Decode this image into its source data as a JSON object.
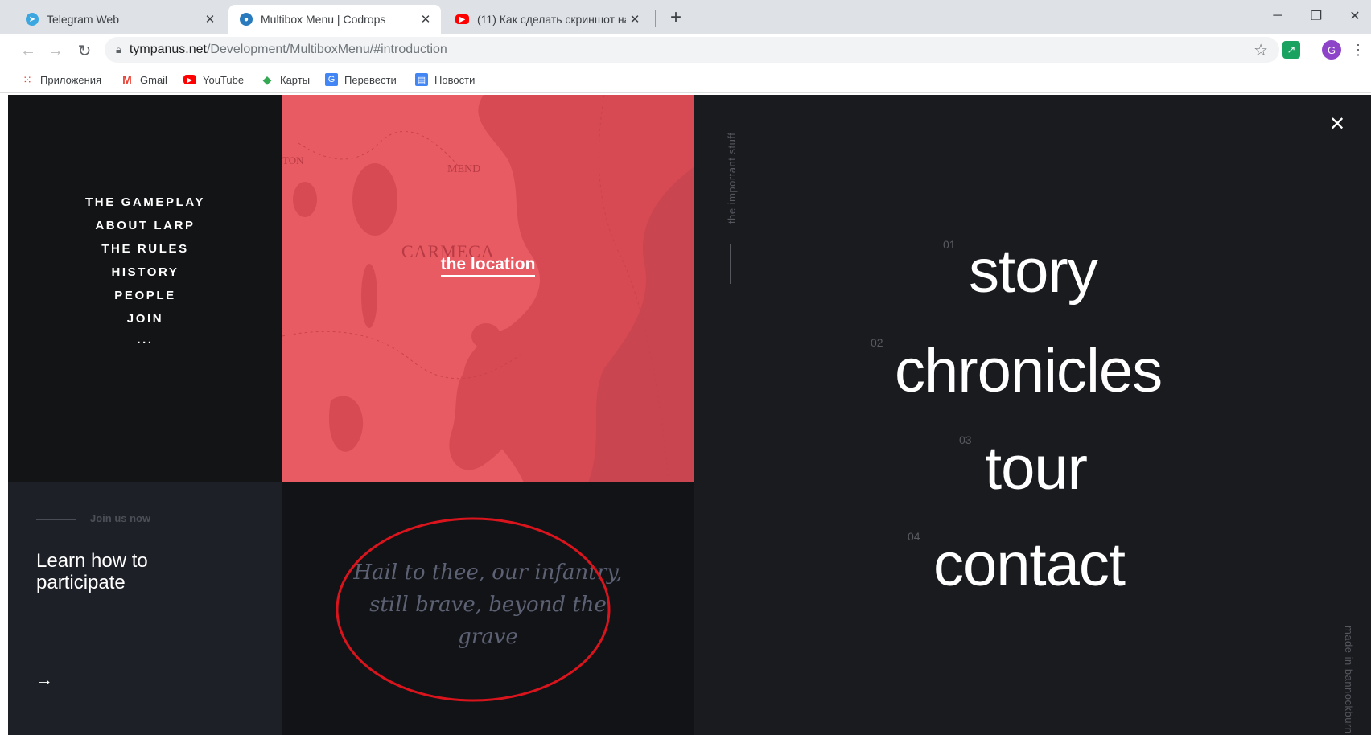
{
  "browser": {
    "tabs": [
      {
        "title": "Telegram Web",
        "icon": "telegram-icon",
        "active": false
      },
      {
        "title": "Multibox Menu | Codrops",
        "icon": "codrops-icon",
        "active": true
      },
      {
        "title": "(11) Как сделать скриншот на н",
        "icon": "youtube-icon",
        "active": false
      }
    ],
    "new_tab_glyph": "+",
    "close_glyph": "✕",
    "window_controls": {
      "minimize": "─",
      "restore": "❐",
      "close": "✕"
    },
    "url": {
      "host": "tympanus.net",
      "path": "/Development/MultiboxMenu/#introduction"
    },
    "avatar_letter": "G",
    "bookmarks": [
      {
        "label": "Приложения",
        "icon": "apps-grid-icon"
      },
      {
        "label": "Gmail",
        "icon": "gmail-icon"
      },
      {
        "label": "YouTube",
        "icon": "youtube-icon"
      },
      {
        "label": "Карты",
        "icon": "maps-icon"
      },
      {
        "label": "Перевести",
        "icon": "translate-icon"
      },
      {
        "label": "Новости",
        "icon": "news-icon"
      }
    ]
  },
  "page": {
    "nav": [
      "THE GAMEPLAY",
      "ABOUT LARP",
      "THE RULES",
      "HISTORY",
      "PEOPLE",
      "JOIN",
      "..."
    ],
    "map": {
      "link_label": "the location",
      "map_name": "CARMECA",
      "map_small_labels": [
        "MEND",
        "TON"
      ]
    },
    "join": {
      "kicker": "Join us now",
      "title_line1": "Learn how to",
      "title_line2": "participate",
      "arrow": "→"
    },
    "quote": {
      "line1": "Hail to thee, our infantry,",
      "line2": "still brave, beyond the",
      "line3": "grave"
    },
    "menu": {
      "side_label_top": "the important stuff",
      "side_label_bottom": "made in bannockburn",
      "close_glyph": "✕",
      "items": [
        {
          "num": "01",
          "label": "story"
        },
        {
          "num": "02",
          "label": "chronicles"
        },
        {
          "num": "03",
          "label": "tour"
        },
        {
          "num": "04",
          "label": "contact"
        }
      ]
    }
  },
  "colors": {
    "map_red": "#e85b63",
    "annotation_red": "#d9141c",
    "page_dark": "#1a1b1f"
  }
}
